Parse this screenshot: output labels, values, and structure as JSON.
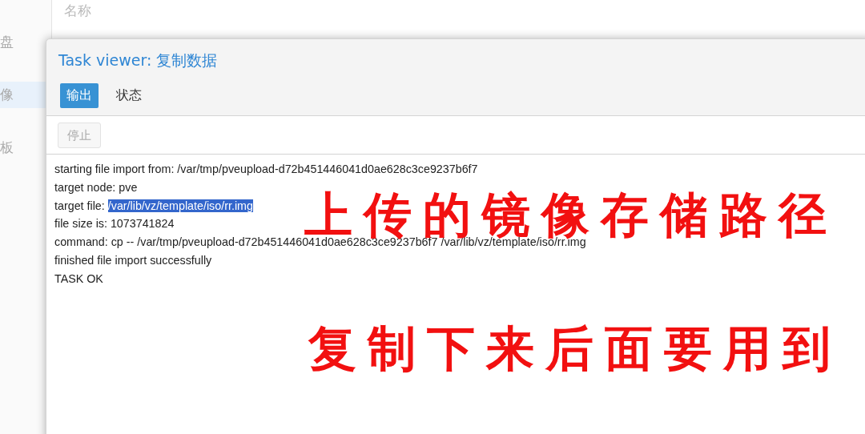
{
  "background": {
    "sidebar_items": [
      {
        "label": "盘",
        "selected": false
      },
      {
        "label": "像",
        "selected": true
      },
      {
        "label": "板",
        "selected": false
      }
    ],
    "column_header": "名称"
  },
  "dialog": {
    "title": "Task viewer: 复制数据",
    "tabs": [
      {
        "label": "输出",
        "selected": true
      },
      {
        "label": "状态",
        "selected": false
      }
    ],
    "toolbar": [
      {
        "label": "停止",
        "disabled": true
      }
    ],
    "log": [
      {
        "text": "starting file import from: /var/tmp/pveupload-d72b451446041d0ae628c3ce9237b6f7"
      },
      {
        "text": "target node: pve"
      },
      {
        "text": "target file: ",
        "highlight": "/var/lib/vz/template/iso/rr.img"
      },
      {
        "text": "file size is: 1073741824"
      },
      {
        "text": "command: cp -- /var/tmp/pveupload-d72b451446041d0ae628c3ce9237b6f7 /var/lib/vz/template/iso/rr.img"
      },
      {
        "text": "finished file import successfully"
      },
      {
        "text": "TASK OK"
      }
    ]
  },
  "annotations": [
    "上传的镜像存储路径",
    "复制下来后面要用到"
  ]
}
